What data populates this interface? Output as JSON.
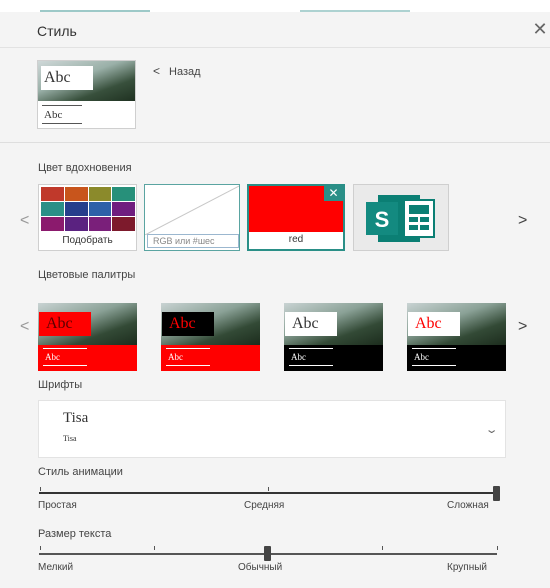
{
  "header": {
    "title": "Стиль",
    "close_glyph": "✕"
  },
  "preview": {
    "abc_large": "Abc",
    "abc_small": "Abc"
  },
  "back": {
    "chevron": "<",
    "label": "Назад"
  },
  "inspiration": {
    "label": "Цвет вдохновения",
    "nav_prev": "<",
    "nav_next": ">",
    "pick_caption": "Подобрать",
    "rgb_placeholder": "RGB или #шес",
    "selected_caption": "red",
    "selected_color": "#ff0000",
    "remove_glyph": "✕",
    "app_icon_letter": "S",
    "swatches": [
      "#c0392b",
      "#c8551c",
      "#8b8a2b",
      "#27907a",
      "#2b8f87",
      "#263e8c",
      "#2d60a8",
      "#6f1d7f",
      "#8b1a6d",
      "#5a2280",
      "#7a1f7a",
      "#7d1a2c"
    ]
  },
  "palettes": {
    "label": "Цветовые палитры",
    "nav_prev": "<",
    "nav_next": ">",
    "items": [
      {
        "abc": "Abc",
        "abc_small": "Abc",
        "top_bg": "#ff0000",
        "text_color": "#5b0000",
        "bottom_bg": "#ff0000",
        "small_color": "#ffffff"
      },
      {
        "abc": "Abc",
        "abc_small": "Abc",
        "top_bg": "#000000",
        "text_color": "#ff0000",
        "bottom_bg": "#ff0000",
        "small_color": "#ffffff"
      },
      {
        "abc": "Abc",
        "abc_small": "Abc",
        "top_bg": "#ffffff",
        "text_color": "#333333",
        "bottom_bg": "#000000",
        "small_color": "#ffffff"
      },
      {
        "abc": "Abc",
        "abc_small": "Abc",
        "top_bg": "#ffffff",
        "text_color": "#ff0000",
        "bottom_bg": "#000000",
        "small_color": "#ffffff"
      }
    ]
  },
  "fonts": {
    "label": "Шрифты",
    "heading_font": "Tisa",
    "body_font": "Tisa",
    "chevron": "⌄"
  },
  "animation": {
    "label": "Стиль анимации",
    "min_label": "Простая",
    "mid_label": "Средняя",
    "max_label": "Сложная",
    "level": 1.0
  },
  "text_size": {
    "label": "Размер текста",
    "min_label": "Мелкий",
    "mid_label": "Обычный",
    "max_label": "Крупный",
    "level": 0.5
  }
}
